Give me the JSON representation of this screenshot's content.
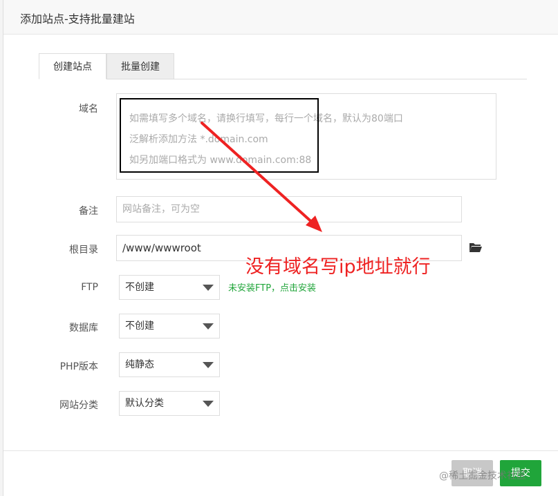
{
  "dialog": {
    "title": "添加站点-支持批量建站"
  },
  "tabs": [
    {
      "label": "创建站点",
      "active": true
    },
    {
      "label": "批量创建",
      "active": false
    }
  ],
  "form": {
    "domain": {
      "label": "域名",
      "placeholder_lines": [
        "如需填写多个域名，请换行填写，每行一个域名，默认为80端口",
        "泛解析添加方法 *.domain.com",
        "如另加端口格式为 www.domain.com:88"
      ]
    },
    "remark": {
      "label": "备注",
      "placeholder": "网站备注，可为空"
    },
    "root": {
      "label": "根目录",
      "value": "/www/wwwroot",
      "icon": "folder-open-icon"
    },
    "ftp": {
      "label": "FTP",
      "selected": "不创建",
      "hint": "未安装FTP，点击安装"
    },
    "database": {
      "label": "数据库",
      "selected": "不创建"
    },
    "php": {
      "label": "PHP版本",
      "selected": "纯静态"
    },
    "category": {
      "label": "网站分类",
      "selected": "默认分类"
    }
  },
  "annotation": {
    "text": "没有域名写ip地址就行",
    "color": "#ee2222"
  },
  "footer": {
    "cancel_label": "取消",
    "submit_label": "提交"
  },
  "watermark": "@稀土掘金技术社区",
  "colors": {
    "accent": "#20a53a",
    "annotation": "#ee2222"
  }
}
